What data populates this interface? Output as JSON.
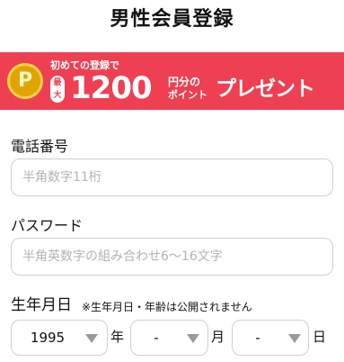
{
  "header": {
    "title": "男性会員登録"
  },
  "banner": {
    "coin_symbol": "P",
    "lead_text": "初めての登録で",
    "max_badge_chars": [
      "最",
      "大"
    ],
    "amount": "1200",
    "unit": "円分の",
    "unit_sub": "ポイント",
    "present": "プレゼント",
    "background_color": "#ef3f52",
    "coin_color": "#e0a400"
  },
  "form": {
    "phone": {
      "label": "電話番号",
      "placeholder": "半角数字11桁",
      "value": ""
    },
    "password": {
      "label": "パスワード",
      "placeholder": "半角英数字の組み合わせ6〜16文字",
      "value": ""
    },
    "birthdate": {
      "label": "生年月日",
      "note": "※生年月日・年齢は公開されません",
      "year": {
        "value": "1995",
        "suffix": "年"
      },
      "month": {
        "value": "-",
        "suffix": "月"
      },
      "day": {
        "value": "-",
        "suffix": "日"
      }
    }
  },
  "icons": {
    "coin": "point-coin-icon",
    "dropdown": "chevron-down-icon"
  }
}
